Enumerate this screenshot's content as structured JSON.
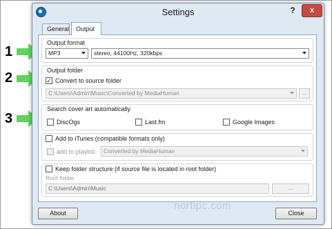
{
  "window": {
    "title": "Settings",
    "help_label": "?",
    "close_label": "x"
  },
  "tabs": [
    {
      "label": "General",
      "active": false
    },
    {
      "label": "Output",
      "active": true
    }
  ],
  "output_format": {
    "group_label": "Output format",
    "format_value": "MP3",
    "quality_value": "stereo, 44100Hz, 320kbps"
  },
  "output_folder": {
    "group_label": "Output folder",
    "convert_to_source_label": "Convert to source folder",
    "convert_to_source_checked": true,
    "path_value": "C:\\Users\\Admin\\Music\\Converted by MediaHuman",
    "browse_label": "..."
  },
  "cover_art": {
    "group_label": "Search cover art automatically",
    "sources": [
      {
        "label": "DiscOgs",
        "checked": false
      },
      {
        "label": "Last.fm",
        "checked": false
      },
      {
        "label": "Google Images",
        "checked": false
      }
    ]
  },
  "itunes": {
    "add_label": "Add to iTunes (compatible formats only)",
    "add_checked": false,
    "playlist_label": "add to playlist:",
    "playlist_value": "Converted by MediaHuman"
  },
  "structure": {
    "keep_label": "Keep folder structure (if source file is located in root folder)",
    "keep_checked": false,
    "root_label": "Root folder",
    "root_value": "C:\\Users\\Admin\\Music",
    "browse_label": "..."
  },
  "footer": {
    "about_label": "About",
    "close_label": "Close"
  },
  "annotations": {
    "numbers": [
      "1",
      "2",
      "3"
    ],
    "arrow_color": "#5fd35a"
  },
  "watermark": "norfipc.com"
}
